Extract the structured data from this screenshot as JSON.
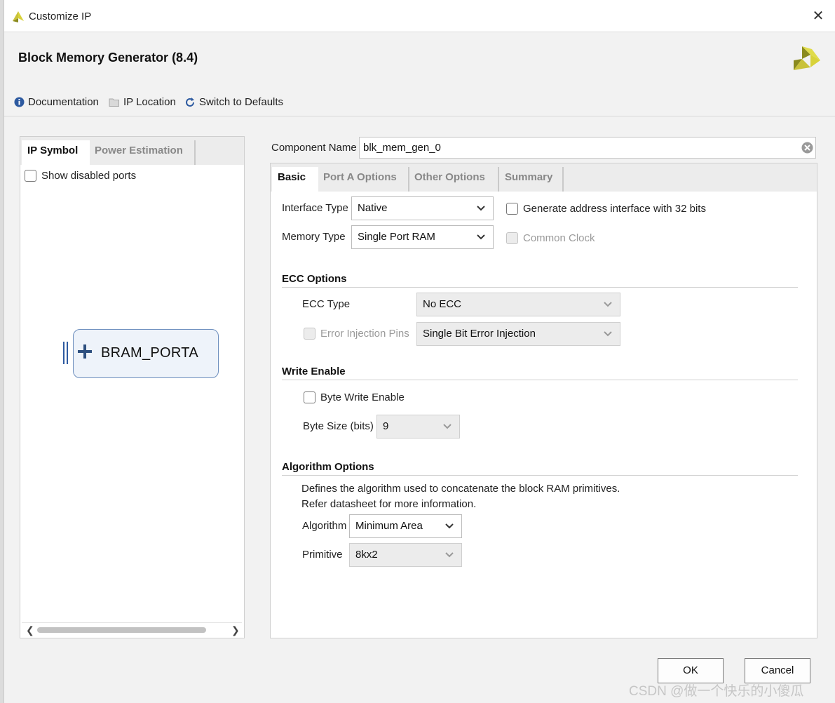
{
  "window": {
    "title": "Customize IP",
    "close_glyph": "✕",
    "header_title": "Block Memory Generator (8.4)"
  },
  "toolbar": {
    "documentation": "Documentation",
    "ip_location": "IP Location",
    "switch_defaults": "Switch to Defaults"
  },
  "left_panel": {
    "tabs": [
      "IP Symbol",
      "Power Estimation"
    ],
    "show_disabled_ports": "Show disabled ports",
    "symbol_label": "BRAM_PORTA"
  },
  "component": {
    "label": "Component Name",
    "value": "blk_mem_gen_0"
  },
  "right_tabs": [
    "Basic",
    "Port A Options",
    "Other Options",
    "Summary"
  ],
  "basic": {
    "interface_type_label": "Interface Type",
    "interface_type_value": "Native",
    "memory_type_label": "Memory Type",
    "memory_type_value": "Single Port RAM",
    "gen_address_32": "Generate address interface with 32 bits",
    "common_clock": "Common Clock",
    "ecc_section": "ECC Options",
    "ecc_type_label": "ECC Type",
    "ecc_type_value": "No ECC",
    "error_injection_pins": "Error Injection Pins",
    "error_injection_value": "Single Bit Error Injection",
    "write_enable_section": "Write Enable",
    "byte_write_enable": "Byte Write Enable",
    "byte_size_label": "Byte Size (bits)",
    "byte_size_value": "9",
    "algorithm_section": "Algorithm Options",
    "algorithm_desc_1": "Defines the algorithm used to concatenate the block RAM primitives.",
    "algorithm_desc_2": "Refer datasheet for more information.",
    "algorithm_label": "Algorithm",
    "algorithm_value": "Minimum Area",
    "primitive_label": "Primitive",
    "primitive_value": "8kx2"
  },
  "buttons": {
    "ok": "OK",
    "cancel": "Cancel"
  },
  "watermark": "CSDN @做一个快乐的小傻瓜",
  "colors": {
    "accent_blue": "#2d5aa0",
    "logo_yellow": "#d8d23a",
    "logo_olive": "#8a8a1e",
    "symbol_border": "#6e8fbe"
  }
}
